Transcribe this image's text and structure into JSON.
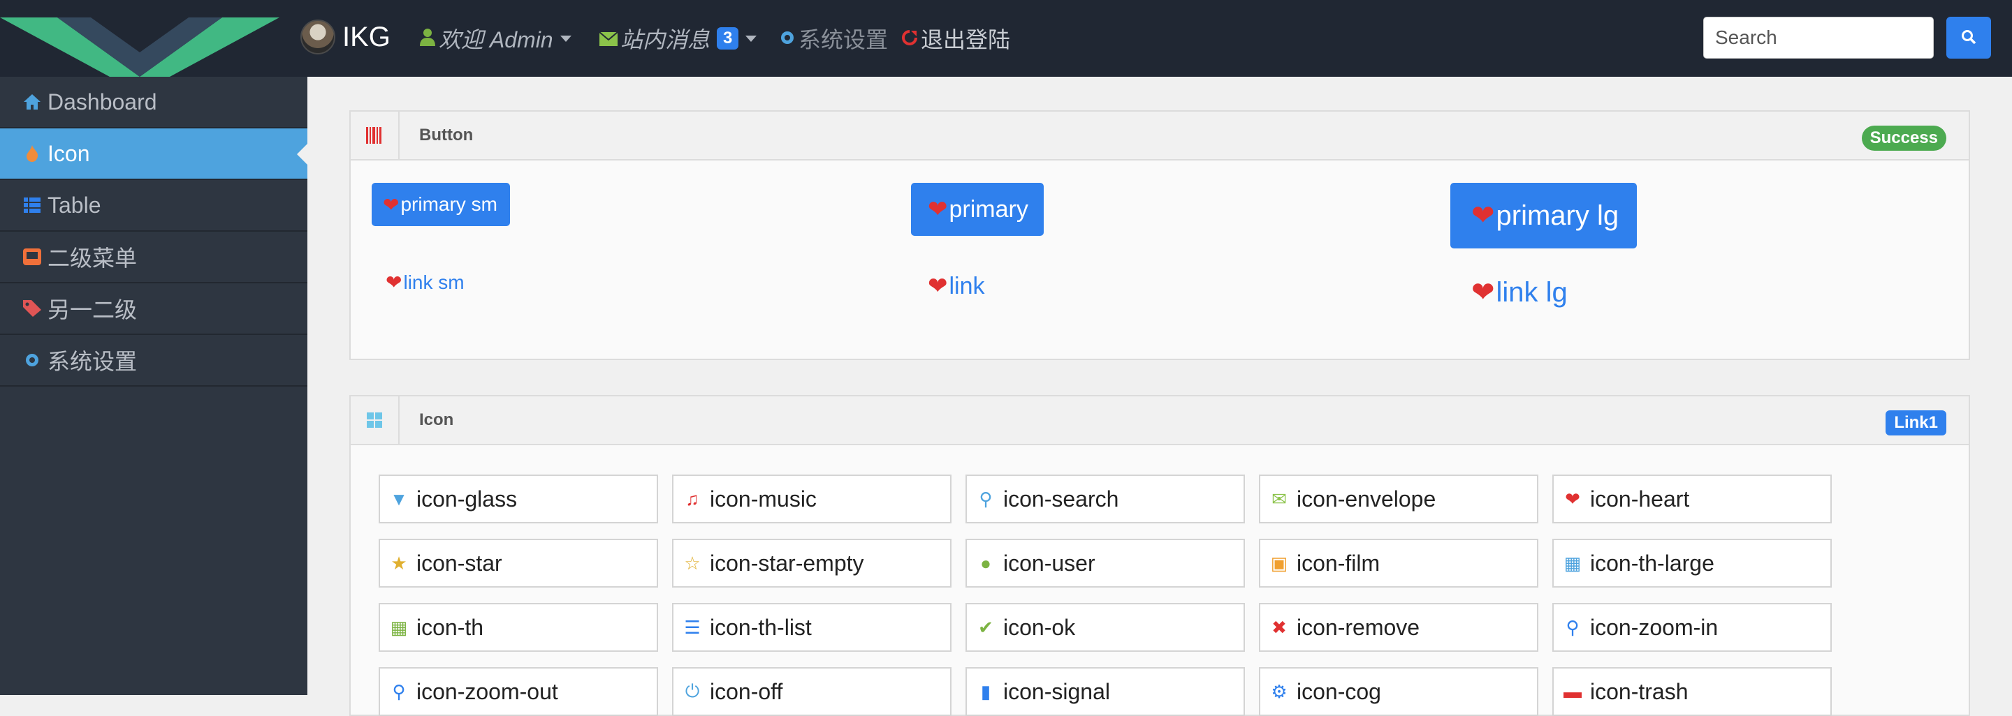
{
  "navbar": {
    "brand": "IKG",
    "welcome": "欢迎 Admin",
    "messages": "站内消息",
    "message_count": "3",
    "settings": "系统设置",
    "logout": "退出登陆",
    "search_placeholder": "Search"
  },
  "sidebar": {
    "items": [
      {
        "label": "Dashboard",
        "icon": "home-icon",
        "active": false
      },
      {
        "label": "Icon",
        "icon": "fire-icon",
        "active": true
      },
      {
        "label": "Table",
        "icon": "th-list-icon",
        "active": false
      },
      {
        "label": "二级菜单",
        "icon": "inbox-icon",
        "active": false
      },
      {
        "label": "另一二级",
        "icon": "tags-icon",
        "active": false
      },
      {
        "label": "系统设置",
        "icon": "cog-icon",
        "active": false
      }
    ]
  },
  "button_panel": {
    "title": "Button",
    "badge": "Success",
    "badge_color": "#4caa50",
    "buttons": [
      {
        "label": "primary sm",
        "style": "primary",
        "size": "sm"
      },
      {
        "label": "primary",
        "style": "primary",
        "size": "md"
      },
      {
        "label": "primary lg",
        "style": "primary",
        "size": "lg"
      },
      {
        "label": "link sm",
        "style": "link",
        "size": "sm"
      },
      {
        "label": "link",
        "style": "link",
        "size": "md"
      },
      {
        "label": "link lg",
        "style": "link",
        "size": "lg"
      }
    ]
  },
  "icon_panel": {
    "title": "Icon",
    "badge": "Link1",
    "badge_color": "#2f80ed",
    "icons": [
      {
        "label": "icon-glass",
        "icon": "glass-icon",
        "color": "#4ea3de"
      },
      {
        "label": "icon-music",
        "icon": "music-icon",
        "color": "#e03131"
      },
      {
        "label": "icon-search",
        "icon": "search-icon",
        "color": "#4ea3de"
      },
      {
        "label": "icon-envelope",
        "icon": "envelope-icon",
        "color": "#8bc34a"
      },
      {
        "label": "icon-heart",
        "icon": "heart-icon",
        "color": "#e03131"
      },
      {
        "label": "icon-star",
        "icon": "star-icon",
        "color": "#e0b030"
      },
      {
        "label": "icon-star-empty",
        "icon": "star-empty-icon",
        "color": "#e0b030"
      },
      {
        "label": "icon-user",
        "icon": "user-icon",
        "color": "#7cb342"
      },
      {
        "label": "icon-film",
        "icon": "film-icon",
        "color": "#f0a030"
      },
      {
        "label": "icon-th-large",
        "icon": "th-large-icon",
        "color": "#4ea3de"
      },
      {
        "label": "icon-th",
        "icon": "th-icon",
        "color": "#7cb342"
      },
      {
        "label": "icon-th-list",
        "icon": "th-list-icon",
        "color": "#2f80ed"
      },
      {
        "label": "icon-ok",
        "icon": "ok-icon",
        "color": "#7cb342"
      },
      {
        "label": "icon-remove",
        "icon": "remove-icon",
        "color": "#e03131"
      },
      {
        "label": "icon-zoom-in",
        "icon": "zoom-in-icon",
        "color": "#2f80ed"
      },
      {
        "label": "icon-zoom-out",
        "icon": "zoom-out-icon",
        "color": "#2f80ed"
      },
      {
        "label": "icon-off",
        "icon": "off-icon",
        "color": "#4ea3de"
      },
      {
        "label": "icon-signal",
        "icon": "signal-icon",
        "color": "#2f80ed"
      },
      {
        "label": "icon-cog",
        "icon": "cog-icon",
        "color": "#2f80ed"
      },
      {
        "label": "icon-trash",
        "icon": "trash-icon",
        "color": "#e03131"
      }
    ]
  }
}
